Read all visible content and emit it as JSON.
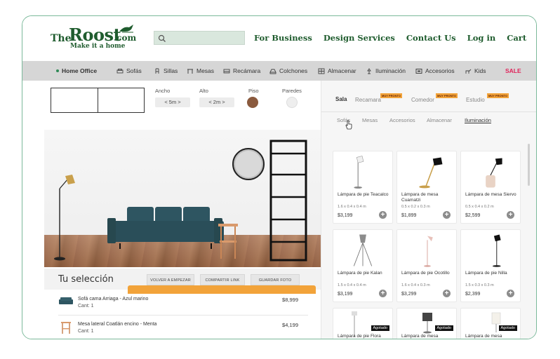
{
  "brand": {
    "logo_the": "The",
    "logo_roost": "Roost",
    "logo_com": ".com",
    "tagline": "Make it a home"
  },
  "header": {
    "search_placeholder": "",
    "links": [
      "For Business",
      "Design Services",
      "Contact Us",
      "Log in",
      "Cart"
    ]
  },
  "categories": [
    {
      "label": "Home Office",
      "icon": "dot-icon",
      "active": true
    },
    {
      "label": "Sofás",
      "icon": "sofa-icon"
    },
    {
      "label": "Sillas",
      "icon": "chair-icon"
    },
    {
      "label": "Mesas",
      "icon": "table-icon"
    },
    {
      "label": "Recámara",
      "icon": "bed-icon"
    },
    {
      "label": "Colchones",
      "icon": "mattress-icon"
    },
    {
      "label": "Almacenar",
      "icon": "storage-icon"
    },
    {
      "label": "Iluminación",
      "icon": "lamp-icon"
    },
    {
      "label": "Accesorios",
      "icon": "frame-icon"
    },
    {
      "label": "Kids",
      "icon": "kids-icon"
    },
    {
      "label": "SALE",
      "icon": "",
      "sale": true
    }
  ],
  "planner": {
    "ancho_label": "Ancho",
    "ancho_value": "<   5m   >",
    "alto_label": "Alto",
    "alto_value": "<   2m   >",
    "piso_label": "Piso",
    "paredes_label": "Paredes",
    "piso_color": "#8a5a3e",
    "paredes_color": "#eeeeee"
  },
  "selection": {
    "title": "Tu selección",
    "buttons": [
      "VOLVER A EMPEZAR",
      "COMPARTIR LINK",
      "GUARDAR FOTO"
    ],
    "items": [
      {
        "name": "Sofá cama Arriaga - Azul marino",
        "qty": "Cant: 1",
        "price": "$8,999"
      },
      {
        "name": "Mesa lateral Coatlán encino - Menta",
        "qty": "Cant: 1",
        "price": "$4,199"
      }
    ]
  },
  "catalog": {
    "rooms": [
      {
        "label": "Sala",
        "active": true
      },
      {
        "label": "Recamara",
        "badge": "MUY PRONTO"
      },
      {
        "label": "Comedor",
        "badge": "MUY PRONTO"
      },
      {
        "label": "Estudio",
        "badge": "MUY PRONTO"
      }
    ],
    "subtabs": [
      "Sofás",
      "Mesas",
      "Accesorios",
      "Almacenar",
      "Iluminación"
    ],
    "active_subtab": "Iluminación",
    "products": [
      {
        "name": "Lámpara de pie Teacalco",
        "dims": "1.6 x 0.4 x 0.4 m",
        "price": "$3,199"
      },
      {
        "name": "Lámpara de mesa Cuamatzi",
        "dims": "0.5 x 0.2 x 0.3 m",
        "price": "$1,899"
      },
      {
        "name": "Lámpara de mesa Siervo",
        "dims": "0.5 x 0.4 x 0.2 m",
        "price": "$2,599"
      },
      {
        "name": "Lámpara de pie Kalan",
        "dims": "1.5 x 0.4 x 0.4 m",
        "price": "$3,199"
      },
      {
        "name": "Lámpara de pie Ocotillo",
        "dims": "1.6 x 0.4 x 0.3 m",
        "price": "$3,299"
      },
      {
        "name": "Lámpara de pie Nilla",
        "dims": "1.5 x 0.3 x 0.3 m",
        "price": "$2,399"
      },
      {
        "name": "Lámpara de pie Flora",
        "agotado": "Agotado"
      },
      {
        "name": "Lámpara de mesa",
        "agotado": "Agotado"
      },
      {
        "name": "Lámpara de mesa",
        "agotado": "Agotado"
      }
    ]
  },
  "colors": {
    "brand_green": "#1f5c2e",
    "sale_pink": "#e0235a",
    "cta_orange": "#f2a33a",
    "sofa_teal": "#2e5561"
  }
}
